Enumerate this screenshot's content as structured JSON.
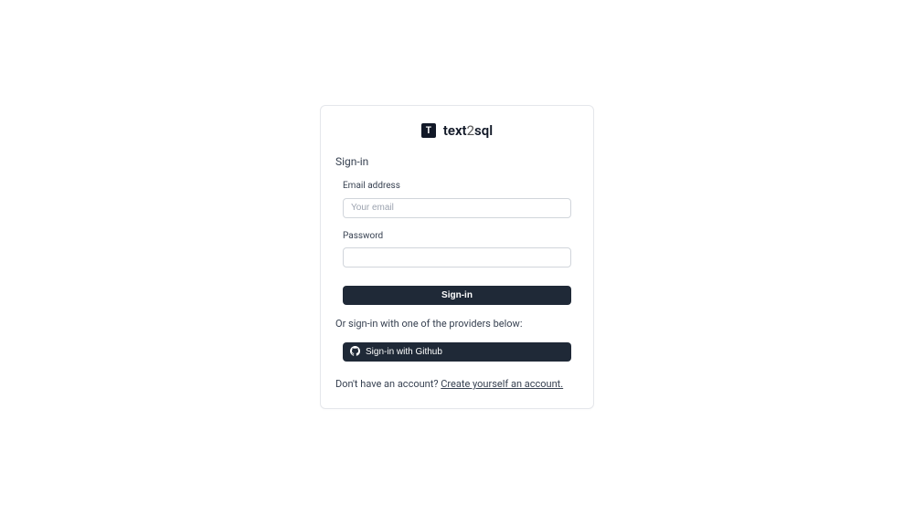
{
  "logo": {
    "badge": "T",
    "text_part1": "text",
    "text_part2": "2",
    "text_part3": "sql"
  },
  "heading": "Sign-in",
  "form": {
    "email_label": "Email address",
    "email_placeholder": "Your email",
    "password_label": "Password",
    "submit_label": "Sign-in"
  },
  "divider_text": "Or sign-in with one of the providers below:",
  "github_btn_label": "Sign-in with Github",
  "footer": {
    "prefix": "Don't have an account? ",
    "link": "Create yourself an account."
  }
}
